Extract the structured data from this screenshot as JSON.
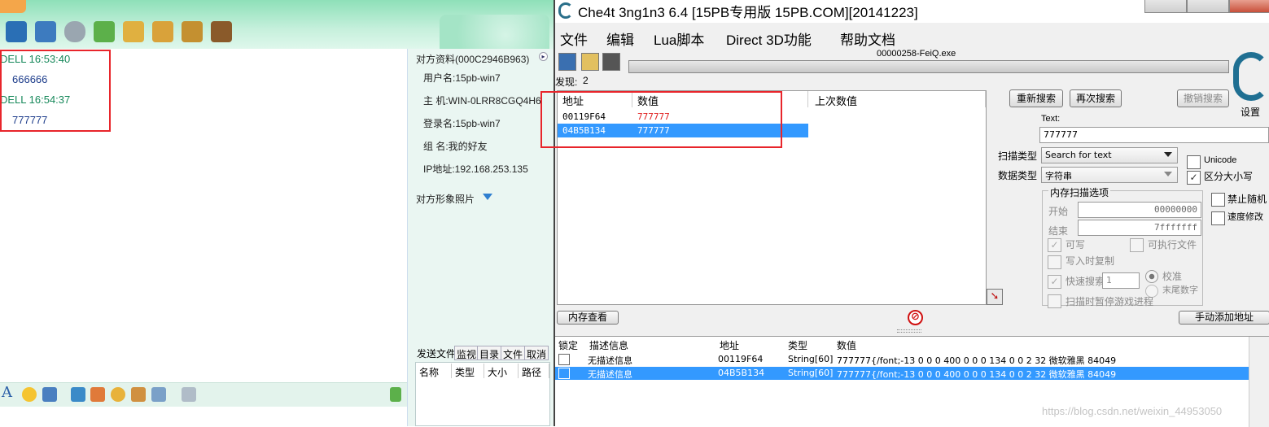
{
  "chat": {
    "messages": [
      {
        "header": "DELL 16:53:40",
        "body": "666666"
      },
      {
        "header": "DELL 16:54:37",
        "body": "777777"
      }
    ],
    "side": {
      "profile_title": "对方资料(000C2946B963)",
      "username": "用户名:15pb-win7",
      "host": "主  机:WIN-0LRR8CGQ4H6",
      "login": "登录名:15pb-win7",
      "group": "组  名:我的好友",
      "ip": "IP地址:192.168.253.135",
      "photo": "对方形象照片"
    },
    "file_tabs": [
      "发送文件",
      "监视",
      "目录",
      "文件",
      "取消"
    ],
    "file_table_headers": [
      "名称",
      "类型",
      "大小",
      "路径"
    ]
  },
  "ce": {
    "title": "Che4t 3ng1n3 6.4 [15PB专用版 15PB.COM][20141223]",
    "menu": [
      "文件",
      "编辑",
      "Lua脚本",
      "Direct 3D功能",
      "帮助文档"
    ],
    "process": "00000258-FeiQ.exe",
    "found_label": "发现:",
    "found_count": "2",
    "results_headers": [
      "地址",
      "数值",
      "上次数值"
    ],
    "results": [
      {
        "address": "00119F64",
        "value": "777777",
        "selected": false
      },
      {
        "address": "04B5B134",
        "value": "777777",
        "selected": true
      }
    ],
    "buttons": {
      "new_scan": "重新搜索",
      "next_scan": "再次搜索",
      "undo_scan": "撤销搜索",
      "settings": "设置",
      "memory_view": "内存查看",
      "add_manual": "手动添加地址"
    },
    "text_label": "Text:",
    "text_value": "777777",
    "scan_type_label": "扫描类型",
    "scan_type_value": "Search for text",
    "value_type_label": "数据类型",
    "value_type_value": "字符串",
    "unicode": "Unicode",
    "case_sensitive": "区分大小写",
    "mem_options": "内存扫描选项",
    "start_label": "开始",
    "start_value": "00000000",
    "stop_label": "结束",
    "stop_value": "7fffffff",
    "writable": "可写",
    "executable": "可执行文件",
    "copy_on_write": "写入时复制",
    "fast_scan": "快速搜索",
    "fast_scan_value": "1",
    "alignment": "校准",
    "last_digits": "末尾数字",
    "pause_game": "扫描时暂停游戏进程",
    "disable_random": "禁止随机",
    "speedhack": "速度修改",
    "addr_list_headers": [
      "锁定",
      "描述信息",
      "地址",
      "类型",
      "数值"
    ],
    "addr_list": [
      {
        "desc": "无描述信息",
        "address": "00119F64",
        "type": "String[60]",
        "value": "777777{/font;-13 0 0 0 400 0 0 0 134 0 0 2 32 微软雅黑 84049",
        "selected": false
      },
      {
        "desc": "无描述信息",
        "address": "04B5B134",
        "type": "String[60]",
        "value": "777777{/font;-13 0 0 0 400 0 0 0 134 0 0 2 32 微软雅黑 84049",
        "selected": true
      }
    ],
    "watermark": "https://blog.csdn.net/weixin_44953050"
  }
}
